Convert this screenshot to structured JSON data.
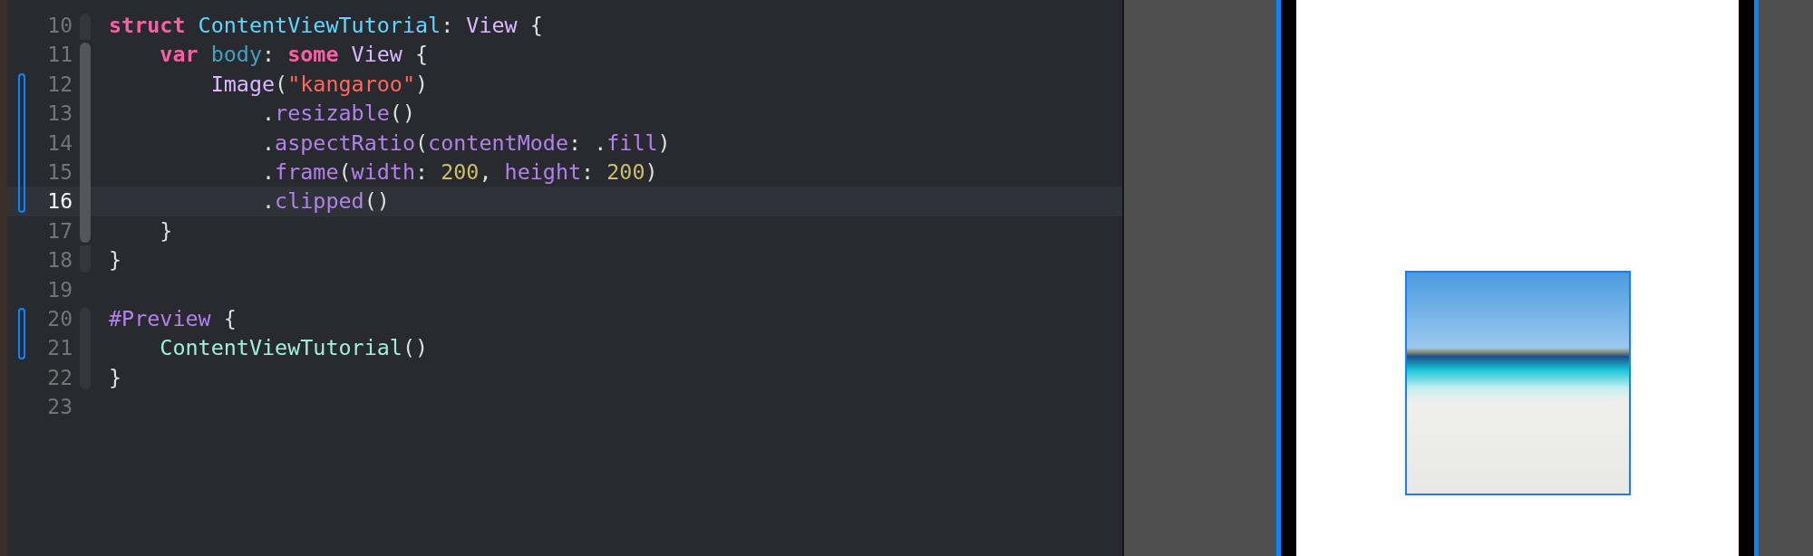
{
  "editor": {
    "lines": [
      {
        "number": "10",
        "current": false,
        "changed": false,
        "foldable": true,
        "nested": false,
        "tokens": [
          {
            "text": "struct",
            "kind": "keyword"
          },
          {
            "text": " ContentViewTutorial",
            "kind": "type_decl"
          },
          {
            "text": ":",
            "kind": "plain"
          },
          {
            "text": " View",
            "kind": "type"
          },
          {
            "text": " {",
            "kind": "plain"
          }
        ]
      },
      {
        "number": "11",
        "current": false,
        "changed": false,
        "foldable": true,
        "nested": true,
        "tokens": [
          {
            "text": "    var",
            "kind": "keyword"
          },
          {
            "text": " body",
            "kind": "decl"
          },
          {
            "text": ":",
            "kind": "plain"
          },
          {
            "text": " some",
            "kind": "keyword"
          },
          {
            "text": " View",
            "kind": "type"
          },
          {
            "text": " {",
            "kind": "plain"
          }
        ]
      },
      {
        "number": "12",
        "current": false,
        "changed": true,
        "foldable": true,
        "nested": true,
        "tokens": [
          {
            "text": "        Image",
            "kind": "type"
          },
          {
            "text": "(",
            "kind": "plain"
          },
          {
            "text": "\"kangaroo\"",
            "kind": "string"
          },
          {
            "text": ")",
            "kind": "plain"
          }
        ]
      },
      {
        "number": "13",
        "current": false,
        "changed": true,
        "foldable": true,
        "nested": true,
        "tokens": [
          {
            "text": "            .",
            "kind": "plain"
          },
          {
            "text": "resizable",
            "kind": "method"
          },
          {
            "text": "()",
            "kind": "plain"
          }
        ]
      },
      {
        "number": "14",
        "current": false,
        "changed": true,
        "foldable": true,
        "nested": true,
        "tokens": [
          {
            "text": "            .",
            "kind": "plain"
          },
          {
            "text": "aspectRatio",
            "kind": "method"
          },
          {
            "text": "(",
            "kind": "plain"
          },
          {
            "text": "contentMode",
            "kind": "method"
          },
          {
            "text": ": .",
            "kind": "plain"
          },
          {
            "text": "fill",
            "kind": "method"
          },
          {
            "text": ")",
            "kind": "plain"
          }
        ]
      },
      {
        "number": "15",
        "current": false,
        "changed": true,
        "foldable": true,
        "nested": true,
        "tokens": [
          {
            "text": "            .",
            "kind": "plain"
          },
          {
            "text": "frame",
            "kind": "method"
          },
          {
            "text": "(",
            "kind": "plain"
          },
          {
            "text": "width",
            "kind": "method"
          },
          {
            "text": ": ",
            "kind": "plain"
          },
          {
            "text": "200",
            "kind": "number"
          },
          {
            "text": ", ",
            "kind": "plain"
          },
          {
            "text": "height",
            "kind": "method"
          },
          {
            "text": ": ",
            "kind": "plain"
          },
          {
            "text": "200",
            "kind": "number"
          },
          {
            "text": ")",
            "kind": "plain"
          }
        ]
      },
      {
        "number": "16",
        "current": true,
        "changed": true,
        "foldable": true,
        "nested": true,
        "tokens": [
          {
            "text": "            .",
            "kind": "plain"
          },
          {
            "text": "clipped",
            "kind": "method"
          },
          {
            "text": "()",
            "kind": "plain"
          }
        ]
      },
      {
        "number": "17",
        "current": false,
        "changed": false,
        "foldable": true,
        "nested": true,
        "tokens": [
          {
            "text": "    }",
            "kind": "plain"
          }
        ]
      },
      {
        "number": "18",
        "current": false,
        "changed": false,
        "foldable": true,
        "nested": false,
        "tokens": [
          {
            "text": "}",
            "kind": "plain"
          }
        ]
      },
      {
        "number": "19",
        "current": false,
        "changed": false,
        "foldable": false,
        "nested": false
      },
      {
        "number": "20",
        "current": false,
        "changed": true,
        "foldable": true,
        "nested": false,
        "tokens": [
          {
            "text": "#Preview",
            "kind": "directive"
          },
          {
            "text": " {",
            "kind": "plain"
          }
        ]
      },
      {
        "number": "21",
        "current": false,
        "changed": true,
        "foldable": true,
        "nested": false,
        "tokens": [
          {
            "text": "    ContentViewTutorial",
            "kind": "project"
          },
          {
            "text": "()",
            "kind": "plain"
          }
        ]
      },
      {
        "number": "22",
        "current": false,
        "changed": false,
        "foldable": true,
        "nested": false,
        "tokens": [
          {
            "text": "}",
            "kind": "plain"
          }
        ]
      },
      {
        "number": "23",
        "current": false,
        "changed": false,
        "foldable": false,
        "nested": false
      }
    ]
  },
  "preview": {
    "selected": true
  }
}
